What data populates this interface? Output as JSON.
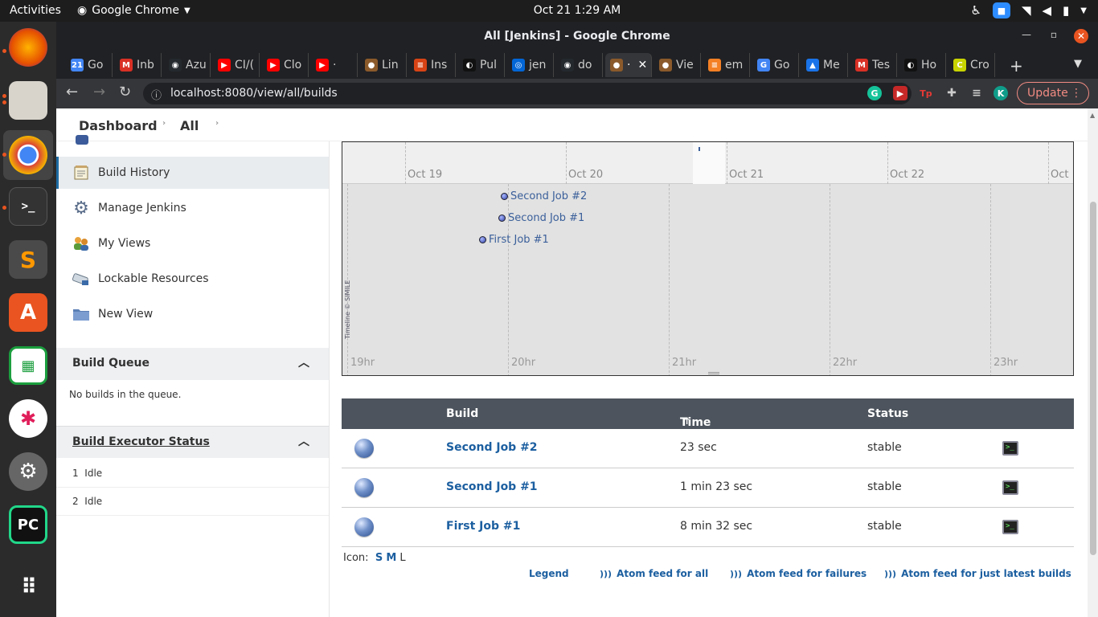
{
  "system": {
    "activities": "Activities",
    "app_name": "Google Chrome",
    "clock": "Oct 21  1:29 AM"
  },
  "window": {
    "title": "All [Jenkins] - Google Chrome"
  },
  "tabs": [
    {
      "label": "Go",
      "color": "#4285f4",
      "glyph": "21"
    },
    {
      "label": "Inb",
      "color": "#d93025",
      "glyph": "M"
    },
    {
      "label": "Azu",
      "color": "#24292e",
      "glyph": "◉"
    },
    {
      "label": "CI/(",
      "color": "#ff0000",
      "glyph": "▶"
    },
    {
      "label": "Clo",
      "color": "#ff0000",
      "glyph": "▶"
    },
    {
      "label": "·",
      "color": "#ff0000",
      "glyph": "▶"
    },
    {
      "label": "Lin",
      "color": "#8b5a2b",
      "glyph": "●"
    },
    {
      "label": "Ins",
      "color": "#d84315",
      "glyph": "≡"
    },
    {
      "label": "Pul",
      "color": "#111111",
      "glyph": "◐"
    },
    {
      "label": "jen",
      "color": "#0366d6",
      "glyph": "◎"
    },
    {
      "label": "do",
      "color": "#24292e",
      "glyph": "◉"
    },
    {
      "label": "·",
      "color": "#8b5a2b",
      "glyph": "●"
    },
    {
      "label": "Vie",
      "color": "#8b5a2b",
      "glyph": "●"
    },
    {
      "label": "em",
      "color": "#f48024",
      "glyph": "≡"
    },
    {
      "label": "Go",
      "color": "#4285f4",
      "glyph": "G"
    },
    {
      "label": "Me",
      "color": "#1a73e8",
      "glyph": "▲"
    },
    {
      "label": "Tes",
      "color": "#d93025",
      "glyph": "M"
    },
    {
      "label": "Ho",
      "color": "#111111",
      "glyph": "◐"
    },
    {
      "label": "Cro",
      "color": "#c8d400",
      "glyph": "C"
    }
  ],
  "omnibox": {
    "url": "localhost:8080/view/all/builds"
  },
  "toolbar": {
    "update_label": "Update",
    "profile_initial": "K"
  },
  "breadcrumb": {
    "dashboard": "Dashboard",
    "all": "All"
  },
  "sidebar": {
    "tasks": [
      {
        "label": "Build History",
        "icon": "notepad-icon",
        "active": true
      },
      {
        "label": "Manage Jenkins",
        "icon": "gear-icon",
        "active": false
      },
      {
        "label": "My Views",
        "icon": "people-icon",
        "active": false
      },
      {
        "label": "Lockable Resources",
        "icon": "lock-resource-icon",
        "active": false
      },
      {
        "label": "New View",
        "icon": "folder-icon",
        "active": false
      }
    ],
    "build_queue": {
      "title": "Build Queue",
      "empty_text": "No builds in the queue."
    },
    "executor_status": {
      "title": "Build Executor Status",
      "executors": [
        {
          "number": "1",
          "state": "Idle"
        },
        {
          "number": "2",
          "state": "Idle"
        }
      ]
    }
  },
  "timeline": {
    "days": [
      "Oct 19",
      "Oct 20",
      "Oct 21",
      "Oct 22",
      "Oct"
    ],
    "hours": [
      "19hr",
      "20hr",
      "21hr",
      "22hr",
      "23hr"
    ],
    "events": [
      "Second Job #2",
      "Second Job #1",
      "First Job #1"
    ],
    "credit": "Timeline © SIMILE"
  },
  "builds_table": {
    "headers": {
      "build": "Build",
      "time_since": "Time Since",
      "sort_indicator": "↑",
      "status": "Status"
    },
    "rows": [
      {
        "build": "Second Job #2",
        "time_since": "23 sec",
        "status": "stable"
      },
      {
        "build": "Second Job #1",
        "time_since": "1 min 23 sec",
        "status": "stable"
      },
      {
        "build": "First Job #1",
        "time_since": "8 min 32 sec",
        "status": "stable"
      }
    ]
  },
  "icon_size": {
    "label": "Icon:",
    "small": "S",
    "medium": "M",
    "large": "L"
  },
  "footer_links": {
    "legend": "Legend",
    "atom_all": "Atom feed for all",
    "atom_failures": "Atom feed for failures",
    "atom_latest": "Atom feed for just latest builds"
  },
  "colors": {
    "accent": "#1c5fa0",
    "table_header": "#4d545d",
    "update": "#f28b82"
  }
}
